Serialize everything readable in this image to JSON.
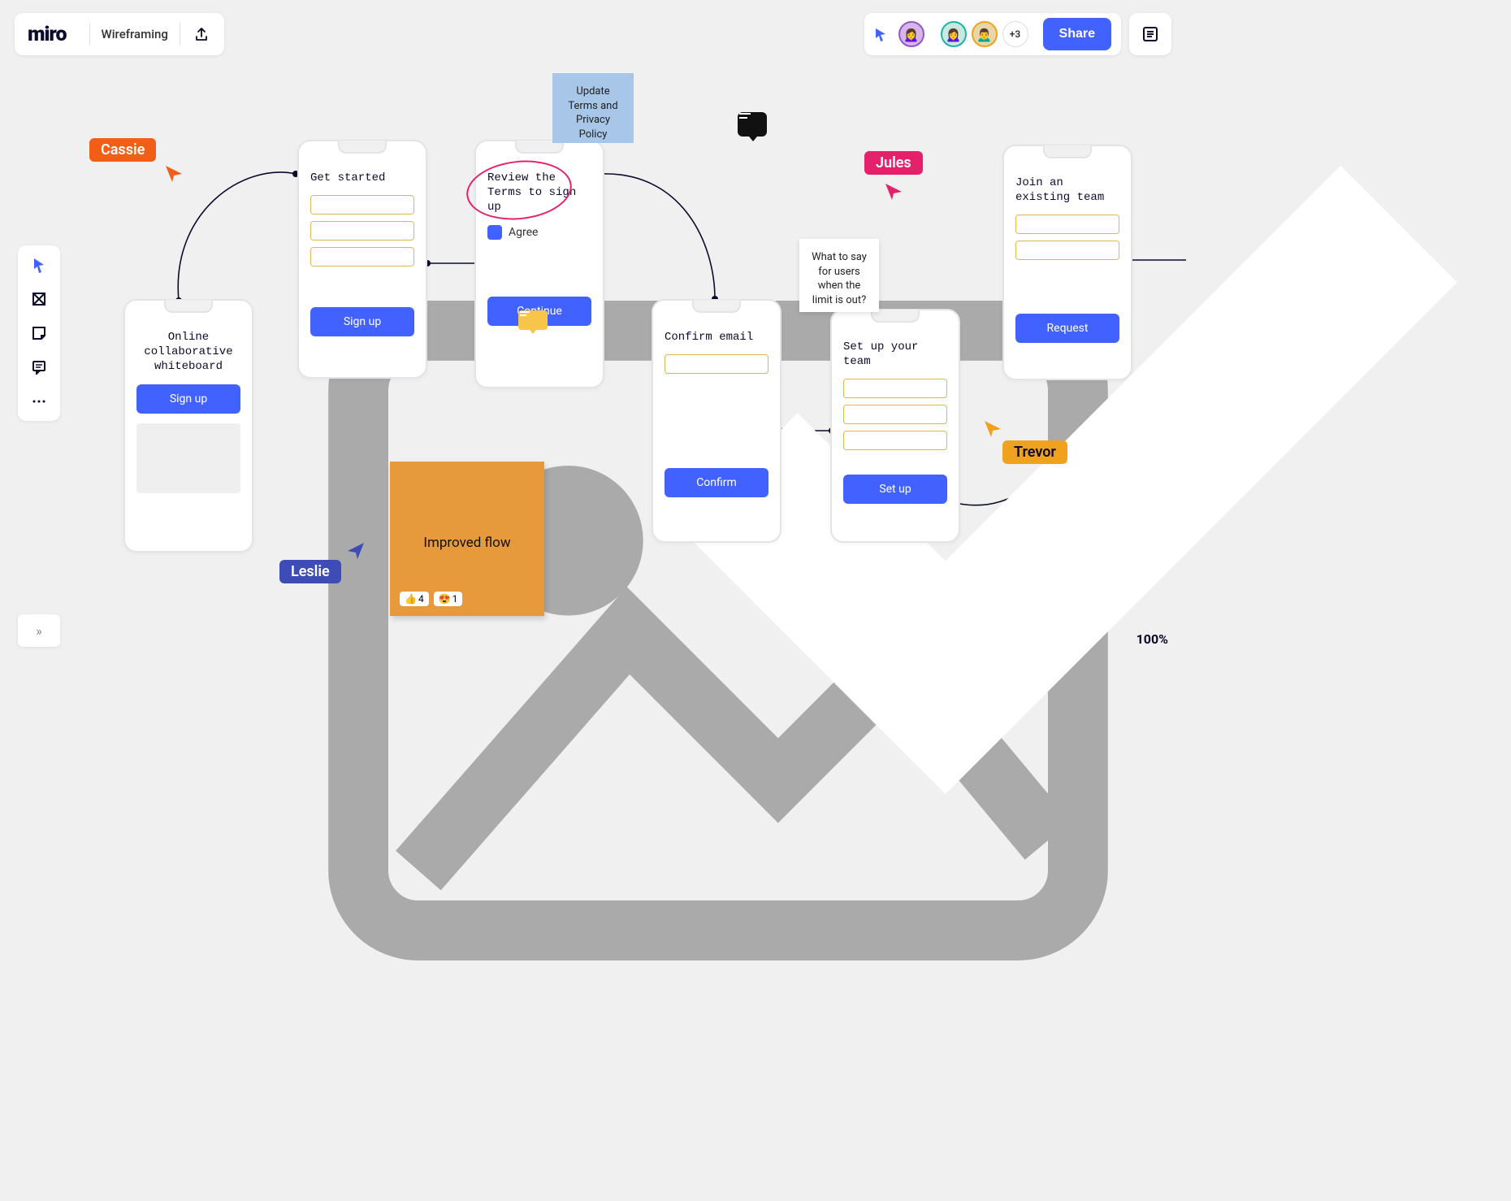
{
  "header": {
    "logo": "miro",
    "board_title": "Wireframing",
    "share_label": "Share",
    "more_collaborators": "+3"
  },
  "zoom": "100%",
  "cursors": {
    "cassie": "Cassie",
    "jules": "Jules",
    "leslie": "Leslie",
    "trevor": "Trevor"
  },
  "stickies": {
    "blue": "Update Terms and Privacy Policy",
    "white": "What to say for users when the limit is out?",
    "orange_title": "Improved flow",
    "react_thumb": "4",
    "react_heart": "1"
  },
  "phones": {
    "p1_title": "Online collaborative whiteboard",
    "p1_btn": "Sign up",
    "p2_title": "Get started",
    "p2_btn": "Sign up",
    "p3_title": "Review the Terms to sign up",
    "p3_agree": "Agree",
    "p3_btn": "Continue",
    "p4_title": "Confirm email",
    "p4_btn": "Confirm",
    "p5_title": "Set up your team",
    "p5_btn": "Set up",
    "p6_title": "Join an existing team",
    "p6_btn": "Request"
  }
}
